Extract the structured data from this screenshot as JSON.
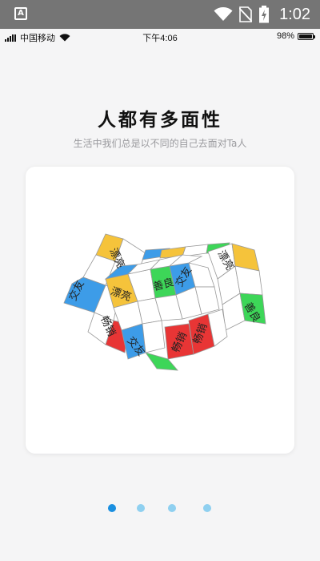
{
  "android_status": {
    "app_icon_letter": "A",
    "time": "1:02"
  },
  "ios_status": {
    "carrier": "中国移动",
    "time": "下午4:06",
    "battery": "98%",
    "battery_level": 0.98
  },
  "onboarding": {
    "title": "人都有多面性",
    "subtitle": "生活中我们总是以不同的自己去面对Ta人"
  },
  "cube_labels": {
    "piaoliang": "漂亮",
    "shanliang": "善良",
    "jiaoyou": "交友",
    "changxiao": "畅销"
  },
  "colors": {
    "yellow": "#f5c33b",
    "green": "#3dd658",
    "blue": "#3d9ce8",
    "red": "#e83535",
    "dot_active": "#1a8fe0",
    "dot_inactive": "#8fd0f0"
  },
  "pagination": {
    "count": 4,
    "active_index": 0
  }
}
